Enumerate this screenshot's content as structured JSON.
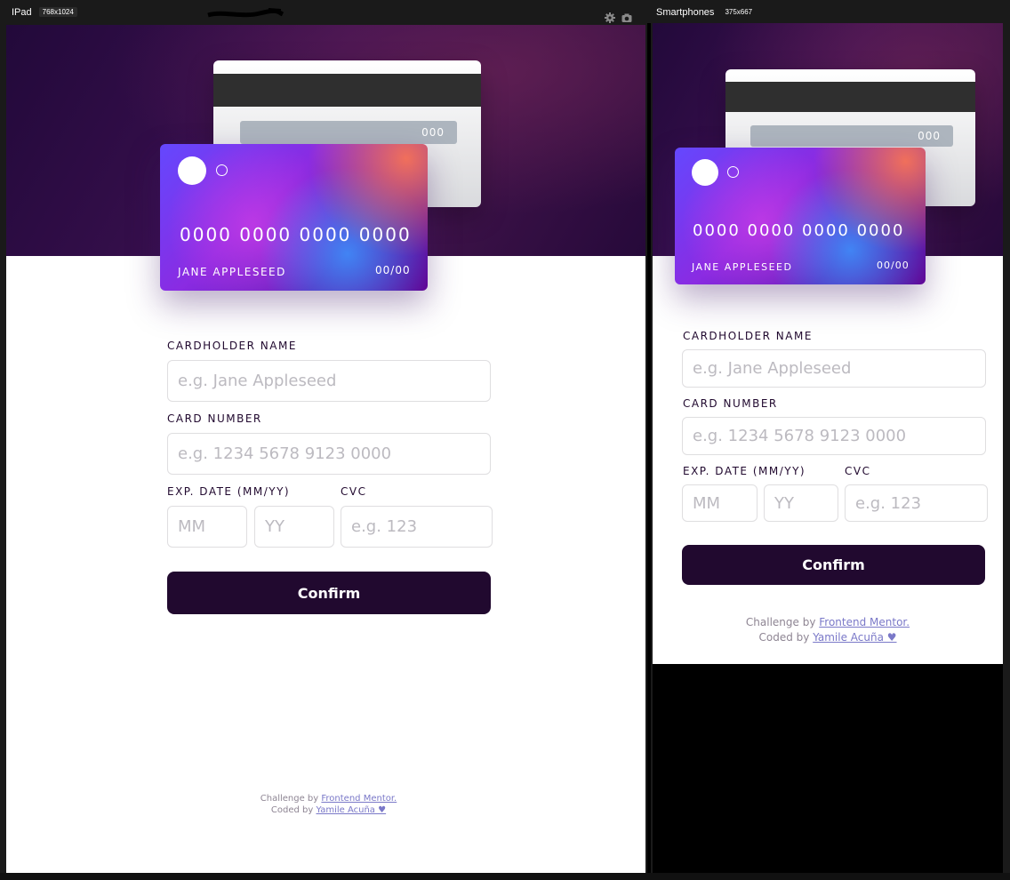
{
  "ipad": {
    "device_name": "IPad",
    "device_size": "768x1024"
  },
  "phone": {
    "device_name": "Smartphones",
    "device_size": "375x667"
  },
  "card": {
    "cvc": "000",
    "number": "0000 0000 0000 0000",
    "name": "JANE APPLESEED",
    "exp": "00/00"
  },
  "form": {
    "name_label": "CARDHOLDER NAME",
    "name_placeholder": "e.g. Jane Appleseed",
    "number_label": "CARD NUMBER",
    "number_placeholder": "e.g. 1234 5678 9123 0000",
    "exp_label": "EXP. DATE (MM/YY)",
    "mm_placeholder": "MM",
    "yy_placeholder": "YY",
    "cvc_label": "CVC",
    "cvc_placeholder": "e.g. 123",
    "confirm_label": "Confirm"
  },
  "footer": {
    "challenge_text": "Challenge by",
    "challenge_link": "Frontend Mentor.",
    "coded_text": "Coded by",
    "coded_link": "Yamile Acuña ♥"
  },
  "toolbar": {
    "icons": [
      "gear-icon",
      "camera-icon"
    ]
  },
  "colors": {
    "dark_violet": "#21092f",
    "input_border": "#dfdee0",
    "placeholder": "#bcbac0",
    "link": "#7a78c8"
  }
}
